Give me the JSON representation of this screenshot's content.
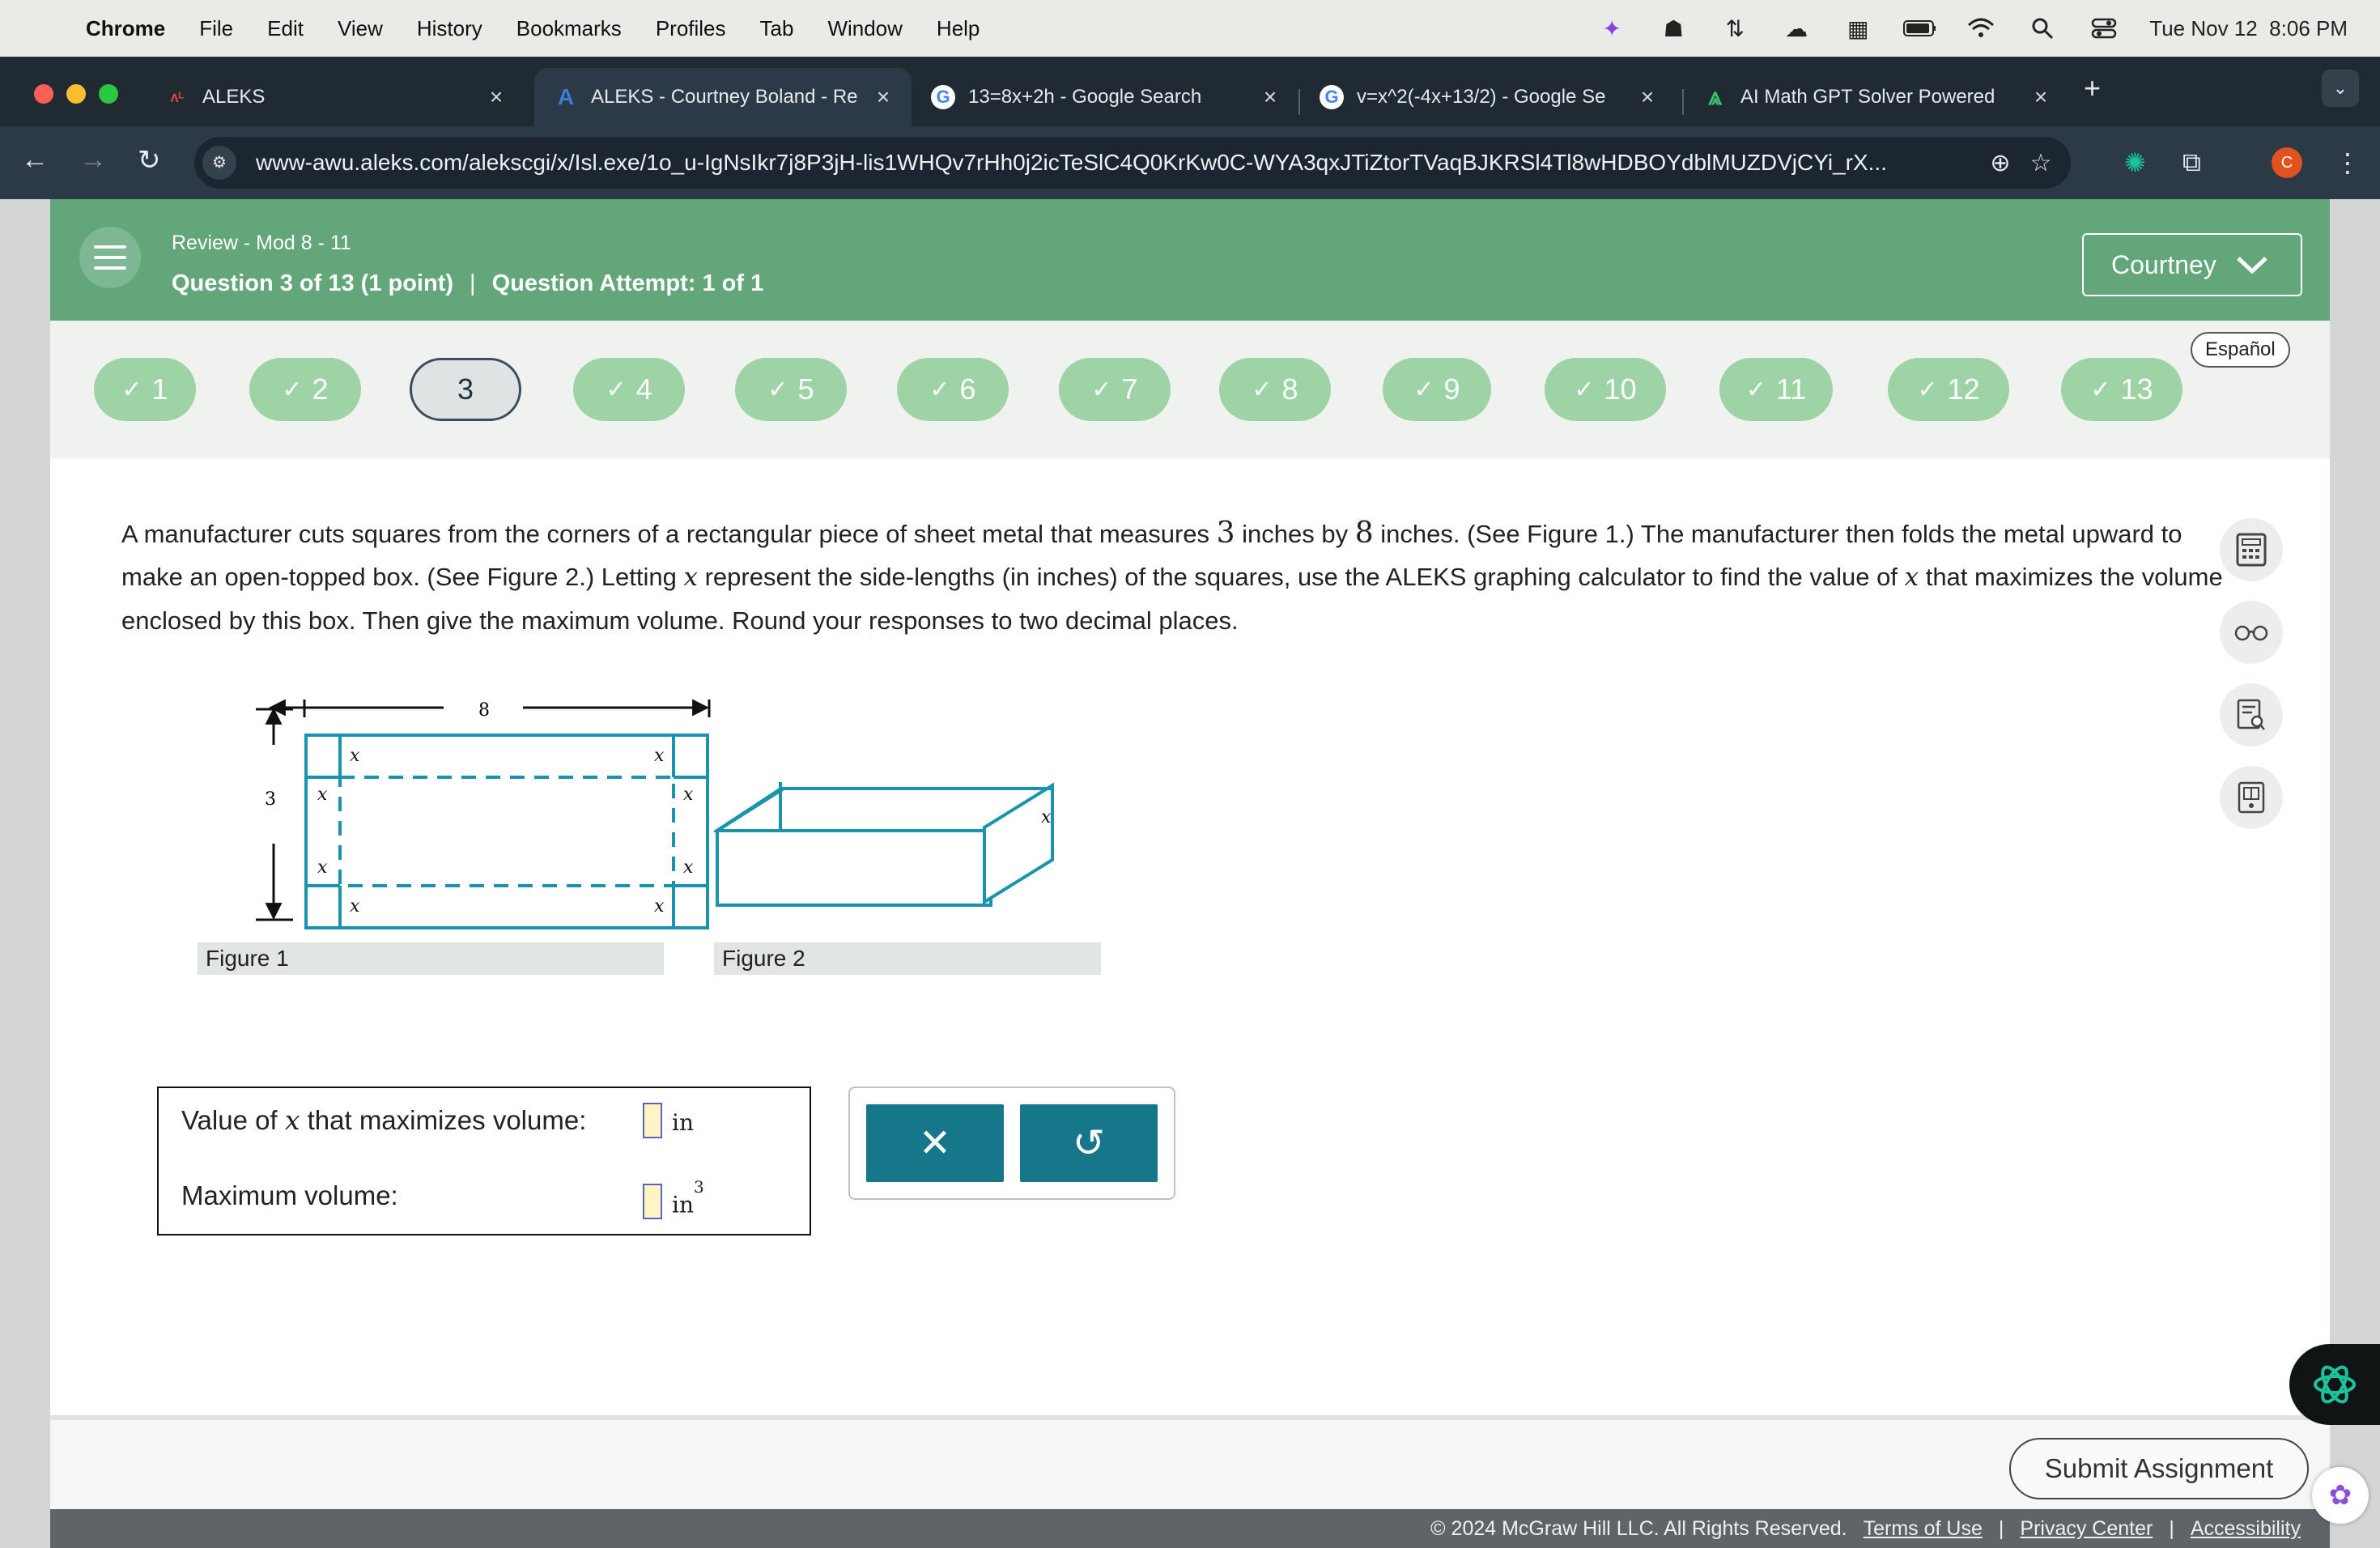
{
  "menubar": {
    "items": [
      "Chrome",
      "File",
      "Edit",
      "View",
      "History",
      "Bookmarks",
      "Profiles",
      "Tab",
      "Window",
      "Help"
    ],
    "datetime": "Tue Nov 12  8:06 PM"
  },
  "tabs": [
    {
      "title": "ALEKS",
      "favicon": "ALEKS-logo"
    },
    {
      "title": "ALEKS - Courtney Boland - Re",
      "favicon": "aleks-a-icon"
    },
    {
      "title": "13=8x+2h - Google Search",
      "favicon": "google-icon"
    },
    {
      "title": "v=x^2(-4x+13/2) - Google Se",
      "favicon": "google-icon"
    },
    {
      "title": "AI Math GPT Solver Powered",
      "favicon": "ai-math-icon"
    }
  ],
  "toolbar": {
    "url": "www-awu.aleks.com/alekscgi/x/Isl.exe/1o_u-IgNsIkr7j8P3jH-lis1WHQv7rHh0j2icTeSlC4Q0KrKw0C-WYA3qxJTiZtorTVaqBJKRSl4Tl8wHDBOYdblMUZDVjCYi_rX...",
    "profile_initial": "C"
  },
  "header": {
    "breadcrumb": "Review - Mod 8 - 11",
    "question_label": "Question 3 of 13 (1 point)",
    "separator": "|",
    "attempt_label": "Question Attempt: 1 of 1",
    "user_name": "Courtney"
  },
  "language_button": "Español",
  "question_nav": [
    {
      "label": "1",
      "done": true
    },
    {
      "label": "2",
      "done": true
    },
    {
      "label": "3",
      "done": false,
      "current": true
    },
    {
      "label": "4",
      "done": true
    },
    {
      "label": "5",
      "done": true
    },
    {
      "label": "6",
      "done": true
    },
    {
      "label": "7",
      "done": true
    },
    {
      "label": "8",
      "done": true
    },
    {
      "label": "9",
      "done": true
    },
    {
      "label": "10",
      "done": true
    },
    {
      "label": "11",
      "done": true
    },
    {
      "label": "12",
      "done": true
    },
    {
      "label": "13",
      "done": true
    }
  ],
  "question": {
    "p1": "A manufacturer cuts squares from the corners of a rectangular piece of sheet metal that measures ",
    "w": "3",
    "p2": " inches by ",
    "l": "8",
    "p3": " inches. (See Figure 1.) The manufacturer then folds the metal upward to make an open-topped box. (See Figure 2.) Letting ",
    "var": "x",
    "p4": " represent the side-lengths (in inches) of the squares, use the ALEKS graphing calculator to find the value of ",
    "p5": " that maximizes the volume enclosed by this box. Then give the maximum volume. Round your responses to two decimal places."
  },
  "figure1": {
    "caption": "Figure 1",
    "width_label": "8",
    "height_label": "3",
    "corner_label": "x"
  },
  "figure2": {
    "caption": "Figure 2",
    "height_label": "x"
  },
  "answers": {
    "x_label_pre": "Value of ",
    "x_label_var": "x",
    "x_label_post": " that maximizes volume:",
    "x_unit": "in",
    "x_value": "",
    "vol_label": "Maximum volume:",
    "vol_unit": "in",
    "vol_exp": "3",
    "vol_value": ""
  },
  "actions": {
    "clear": "✕",
    "undo": "↺"
  },
  "footer": {
    "submit": "Submit Assignment",
    "copyright": "© 2024 McGraw Hill LLC. All Rights Reserved.",
    "links": [
      "Terms of Use",
      "Privacy Center",
      "Accessibility"
    ],
    "sep": "|"
  },
  "colors": {
    "aleks_green": "#62a67a",
    "pill_green": "#9ed3a6",
    "teal": "#17778a",
    "figure_teal": "#1a93ad"
  }
}
